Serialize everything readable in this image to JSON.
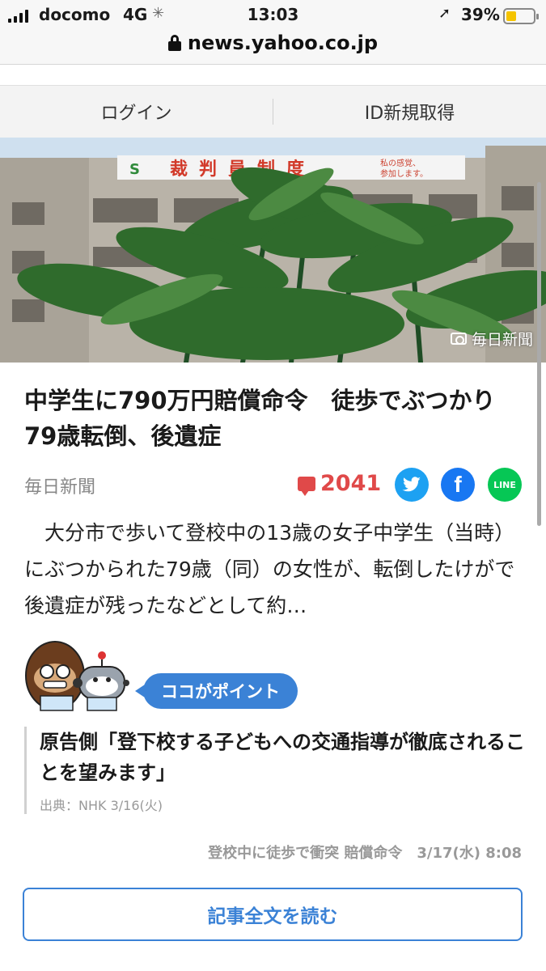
{
  "status_bar": {
    "carrier": "docomo",
    "network": "4G",
    "time": "13:03",
    "battery_percent": "39%",
    "battery_level": 0.39
  },
  "browser": {
    "url": "news.yahoo.co.jp"
  },
  "login_bar": {
    "login_label": "ログイン",
    "register_label": "ID新規取得"
  },
  "photo": {
    "credit": "毎日新聞",
    "sign_text": "裁判員制度",
    "sign_small_line1": "私の感覚、",
    "sign_small_line2": "参加します。"
  },
  "article": {
    "headline": "中学生に790万円賠償命令　徒歩でぶつかり79歳転倒、後遺症",
    "source": "毎日新聞",
    "comment_count": "2041",
    "lead": "　大分市で歩いて登校中の13歳の女子中学生（当時）にぶつかられた79歳（同）の女性が、転倒したけがで後遺症が残ったなどとして約…"
  },
  "share": {
    "twitter_icon": "twitter-bird-icon",
    "facebook_letter": "f",
    "line_label": "LINE"
  },
  "point": {
    "tag": "ココがポイント",
    "quote": "原告側「登下校する子どもへの交通指導が徹底されることを望みます」",
    "quote_source": "出典：NHK 3/16(火)"
  },
  "related": {
    "text": "登校中に徒歩で衝突 賠償命令　3/17(水) 8:08"
  },
  "read_more": {
    "label": "記事全文を読む"
  },
  "colors": {
    "accent_blue": "#3b82d6",
    "comment_red": "#e04949",
    "twitter": "#1da1f2",
    "facebook": "#1877f2",
    "line": "#06c755"
  }
}
